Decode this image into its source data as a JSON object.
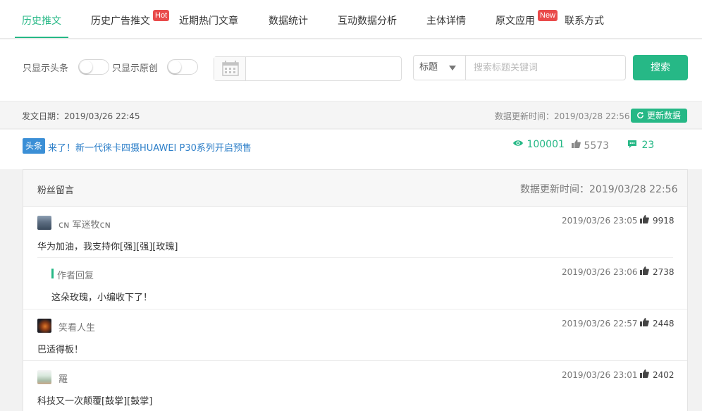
{
  "tabs": [
    {
      "label": "历史推文",
      "active": true
    },
    {
      "label": "历史广告推文",
      "badge": "Hot"
    },
    {
      "label": "近期热门文章"
    },
    {
      "label": "数据统计"
    },
    {
      "label": "互动数据分析"
    },
    {
      "label": "主体详情"
    },
    {
      "label": "原文应用",
      "badge": "New"
    },
    {
      "label": "联系方式"
    }
  ],
  "filters": {
    "only_headline_label": "只显示头条",
    "only_original_label": "只显示原创",
    "only_headline_on": false,
    "only_original_on": false,
    "date_value": "",
    "search_field_selected": "标题",
    "search_placeholder": "搜索标题关键词",
    "search_button": "搜索"
  },
  "info": {
    "publish_date": "发文日期：2019/03/26 22:45",
    "update_time": "数据更新时间：2019/03/28 22:56",
    "refresh_button": "更新数据"
  },
  "article": {
    "tag": "头条",
    "title": "来了！新一代徕卡四摄HUAWEI P30系列开启预售",
    "views": "100001",
    "likes": "5573",
    "comments": "23"
  },
  "comments_panel": {
    "title": "粉丝留言",
    "update_time": "数据更新时间：2019/03/28 22:56",
    "items": [
      {
        "name": "ᴄɴ 军迷牧ᴄɴ",
        "time": "2019/03/26 23:05",
        "likes": "9918",
        "text": "华为加油，我支持你[强][强][玫瑰]",
        "reply": {
          "label": "作者回复",
          "time": "2019/03/26 23:06",
          "likes": "2738",
          "text": "这朵玫瑰，小编收下了！"
        }
      },
      {
        "name": "笑看人生",
        "time": "2019/03/26 22:57",
        "likes": "2448",
        "text": "巴适得板！"
      },
      {
        "name": "羅",
        "time": "2019/03/26 23:01",
        "likes": "2402",
        "text": "科技又一次颠覆[鼓掌][鼓掌]"
      }
    ]
  },
  "colors": {
    "accent": "#26b886",
    "link": "#2f80c9",
    "badge": "#e94b4b",
    "tag": "#3b8fd6"
  }
}
